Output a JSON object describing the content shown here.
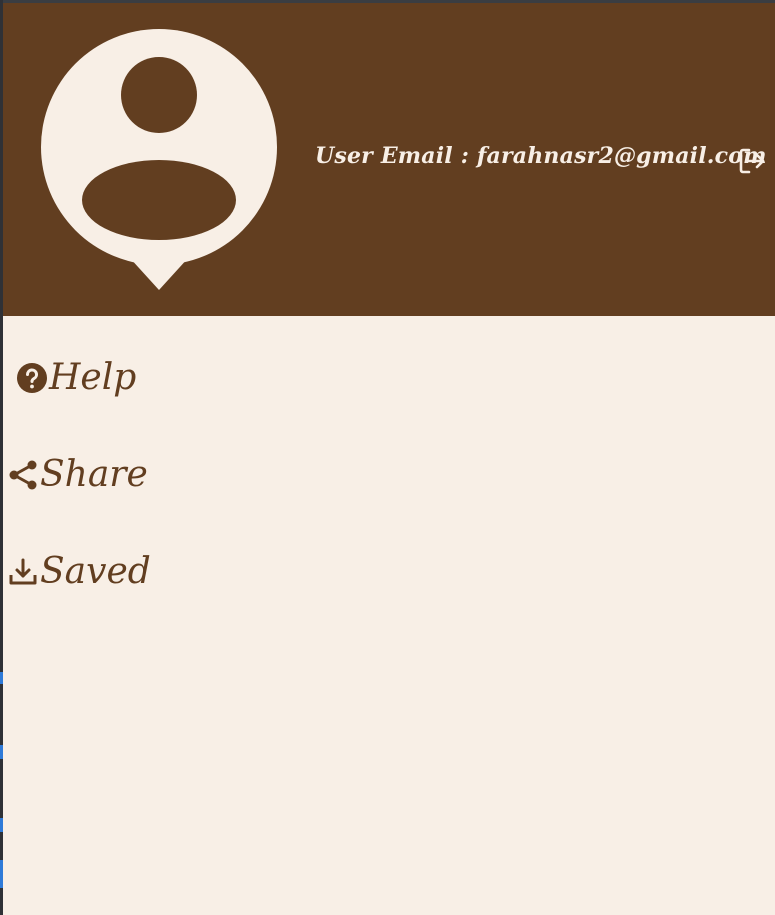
{
  "header": {
    "user_email": "User Email : farahnasr2@gmail.com",
    "avatar_icon": "user-location-pin-icon",
    "logout_icon": "logout-icon"
  },
  "menu": {
    "items": [
      {
        "label": "Help",
        "icon": "help-circle-icon"
      },
      {
        "label": "Share",
        "icon": "share-icon"
      },
      {
        "label": "Saved",
        "icon": "download-icon"
      }
    ]
  },
  "colors": {
    "header_bg": "#623e20",
    "drawer_bg": "#f8efe6",
    "text_accent": "#623e20",
    "header_text": "#f8efe6"
  }
}
